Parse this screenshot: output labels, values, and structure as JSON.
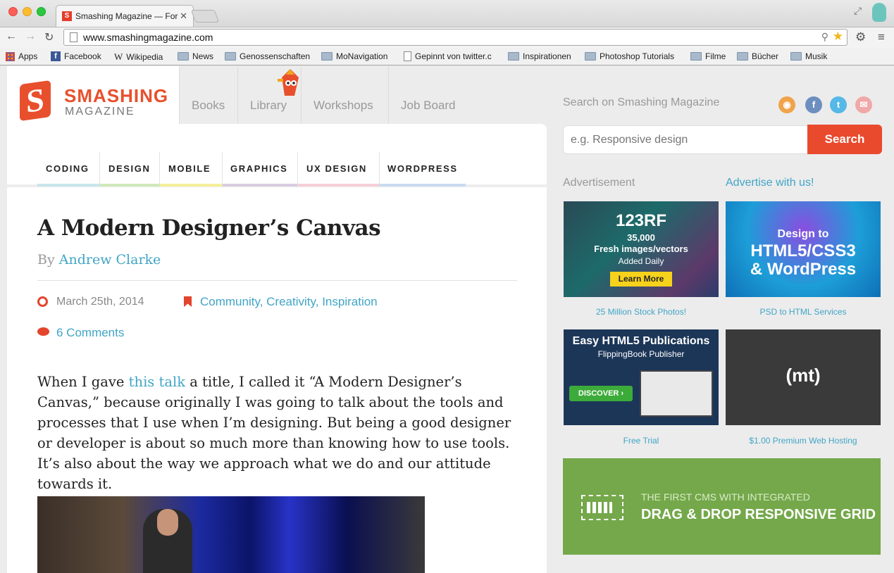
{
  "browser": {
    "tab_title": "Smashing Magazine — For",
    "tab_close": "✕",
    "url": "www.smashingmagazine.com",
    "bookmarks": [
      {
        "label": "Apps"
      },
      {
        "label": "Facebook"
      },
      {
        "label": "Wikipedia"
      },
      {
        "label": "News"
      },
      {
        "label": "Genossenschaften"
      },
      {
        "label": "MoNavigation"
      },
      {
        "label": "Gepinnt von twitter.c"
      },
      {
        "label": "Inspirationen"
      },
      {
        "label": "Photoshop Tutorials"
      },
      {
        "label": "Filme"
      },
      {
        "label": "Bücher"
      },
      {
        "label": "Musik"
      }
    ]
  },
  "site": {
    "logo_top": "SMASHING",
    "logo_bottom": "MAGAZINE",
    "logo_letter": "S",
    "nav": [
      "Books",
      "Library",
      "Workshops",
      "Job Board"
    ],
    "categories": [
      "CODING",
      "DESIGN",
      "MOBILE",
      "GRAPHICS",
      "UX DESIGN",
      "WORDPRESS"
    ],
    "category_colors": [
      "#c7e6ec",
      "#cfe8b9",
      "#f5ef9a",
      "#d9cde0",
      "#f6cfd9",
      "#c9dbf2"
    ]
  },
  "article": {
    "title": "A Modern Designer’s Canvas",
    "by": "By",
    "author": "Andrew Clarke",
    "date": "March 25th, 2014",
    "category_links": [
      "Community",
      "Creativity",
      "Inspiration"
    ],
    "comments": "6 Comments",
    "body_before": "When I gave ",
    "body_link": "this talk",
    "body_after": " a title, I called it “A Modern Designer’s Canvas,” because originally I was going to talk about the tools and processes that I use when I’m designing. But being a good designer or developer is about so much more than knowing how to use tools. It’s also about the way we approach what we do and our attitude towards it."
  },
  "sidebar": {
    "search_label": "Search on Smashing Magazine",
    "search_placeholder": "e.g. Responsive design",
    "search_button": "Search",
    "ad_label": "Advertisement",
    "advertise_link": "Advertise with us!",
    "ads": [
      {
        "lines": [
          "123RF",
          "35,000",
          "Fresh images/vectors",
          "Added Daily",
          "Learn More"
        ],
        "caption": "25 Million Stock Photos!"
      },
      {
        "lines": [
          "Design to",
          "HTML5/CSS3",
          "& WordPress"
        ],
        "caption": "PSD to HTML Services"
      },
      {
        "lines": [
          "Easy HTML5 Publications",
          "FlippingBook Publisher",
          "DISCOVER ›"
        ],
        "caption": "Free Trial"
      },
      {
        "lines": [
          "(mt)"
        ],
        "caption": "$1.00 Premium Web Hosting"
      }
    ],
    "cms_line1": "THE FIRST CMS WITH INTEGRATED",
    "cms_line2": "DRAG & DROP RESPONSIVE GRID"
  }
}
